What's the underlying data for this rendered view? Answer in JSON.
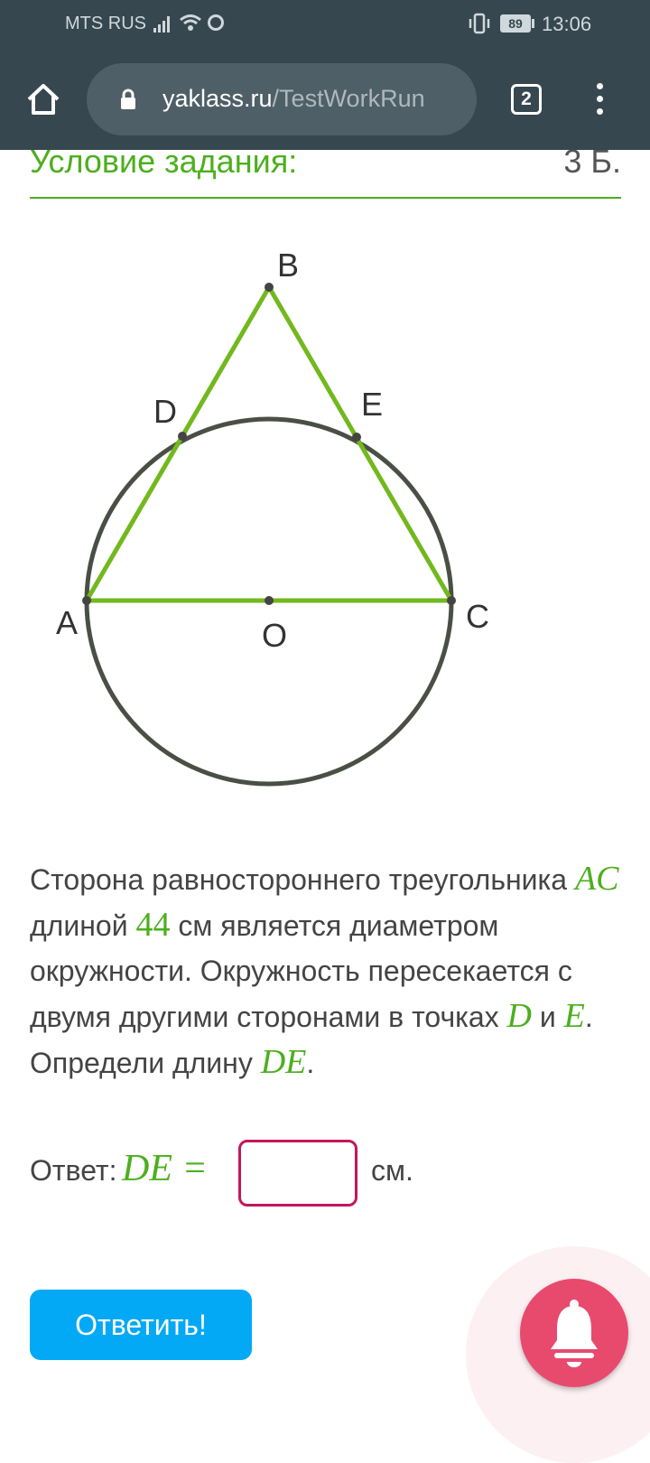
{
  "status_bar": {
    "carrier": "MTS RUS",
    "battery": "89",
    "time": "13:06"
  },
  "browser": {
    "url_domain": "yaklass.ru",
    "url_path": "/TestWorkRun",
    "tab_count": "2"
  },
  "task": {
    "title": "Условие задания:",
    "points": "3 Б."
  },
  "figure": {
    "labels": {
      "B": "B",
      "D": "D",
      "E": "E",
      "A": "A",
      "O": "O",
      "C": "C"
    }
  },
  "problem": {
    "t1": "Сторона равностороннего треугольника ",
    "m1": "AC",
    "t2": " длиной ",
    "m2": "44",
    "t3": " см является диаметром окружности. Окружность пересекается с двумя другими сторонами в точках ",
    "m3": "D",
    "t4": " и ",
    "m4": "E",
    "t5": ". Определи длину ",
    "m5": "DE",
    "t6": "."
  },
  "answer": {
    "prefix": "Ответ:",
    "math": "DE =",
    "value": "",
    "unit": "см."
  },
  "submit_label": "Ответить!",
  "colors": {
    "accent_green": "#4caf1e",
    "button_blue": "#03a9f4",
    "input_border": "#c2185b",
    "bell_pink": "#e84a6e",
    "chrome": "#37474f"
  }
}
